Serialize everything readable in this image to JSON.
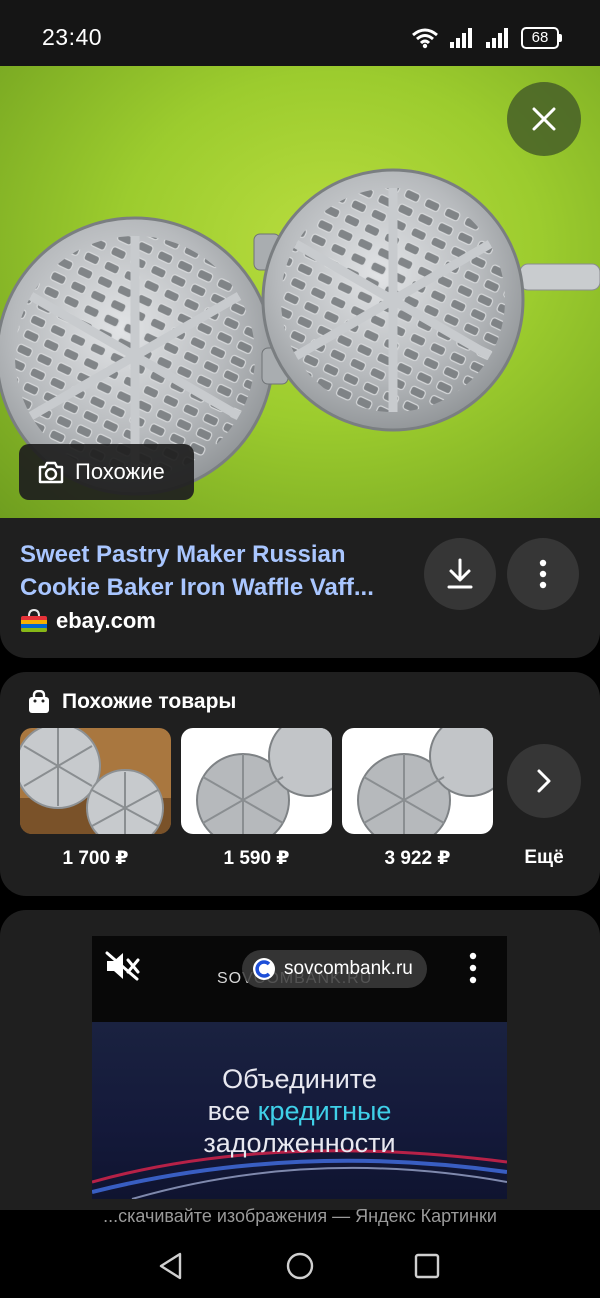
{
  "status_bar": {
    "time": "23:40",
    "battery": "68"
  },
  "hero": {
    "close_icon": "close-icon",
    "similar_button_label": "Похожие"
  },
  "result": {
    "title_line1": "Sweet Pastry Maker Russian",
    "title_line2": "Cookie Baker Iron Waffle Vaff...",
    "source": "ebay.com"
  },
  "similar_products": {
    "title": "Похожие товары",
    "items": [
      {
        "price": "1 700 ₽"
      },
      {
        "price": "1 590 ₽"
      },
      {
        "price": "3 922 ₽"
      }
    ],
    "more_label": "Ещё"
  },
  "ad": {
    "brand": "SOVCOMBANK.RU",
    "chip": "sovcombank.ru",
    "line1": "Объедините",
    "line2_a": "все ",
    "line2_b": "кредитные",
    "line3": "задолженности",
    "caption": "...скачивайте изображения — Яндекс Картинки"
  },
  "colors": {
    "title_link": "#a9c6ff",
    "card": "#1f1f1f",
    "hero_bg": "#9ccc2e",
    "ad_highlight": "#3fd0e8"
  }
}
